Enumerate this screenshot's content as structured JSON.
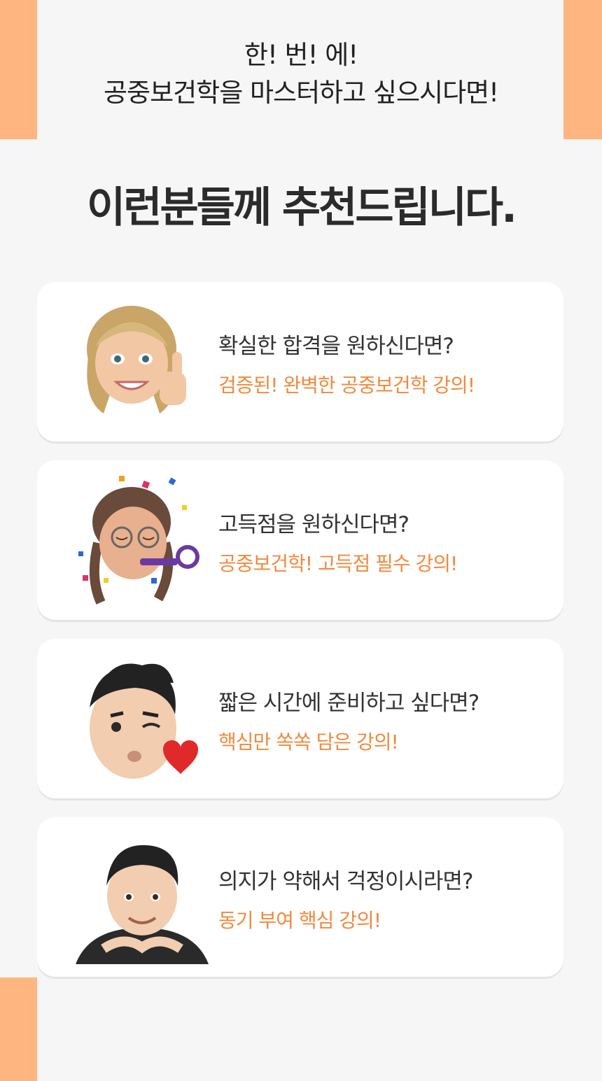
{
  "intro": {
    "line1": "한! 번! 에!",
    "line2": "공중보건학을 마스터하고 싶으시다면!"
  },
  "headline": "이런분들께 추천드립니다.",
  "colors": {
    "accent_bar": "#ffb57f",
    "answer_text": "#f2893c",
    "background": "#f6f6f6"
  },
  "cards": [
    {
      "icon": "thumbs-up-avatar-icon",
      "question": "확실한 합격을 원하신다면?",
      "answer": "검증된! 완벽한 공중보건학 강의!"
    },
    {
      "icon": "party-avatar-icon",
      "question": "고득점을 원하신다면?",
      "answer": "공중보건학! 고득점 필수 강의!"
    },
    {
      "icon": "wink-heart-avatar-icon",
      "question": "짧은 시간에 준비하고 싶다면?",
      "answer": "핵심만 쏙쏙 담은 강의!"
    },
    {
      "icon": "smiling-avatar-icon",
      "question": "의지가 약해서 걱정이시라면?",
      "answer": "동기 부여 핵심 강의!"
    }
  ]
}
